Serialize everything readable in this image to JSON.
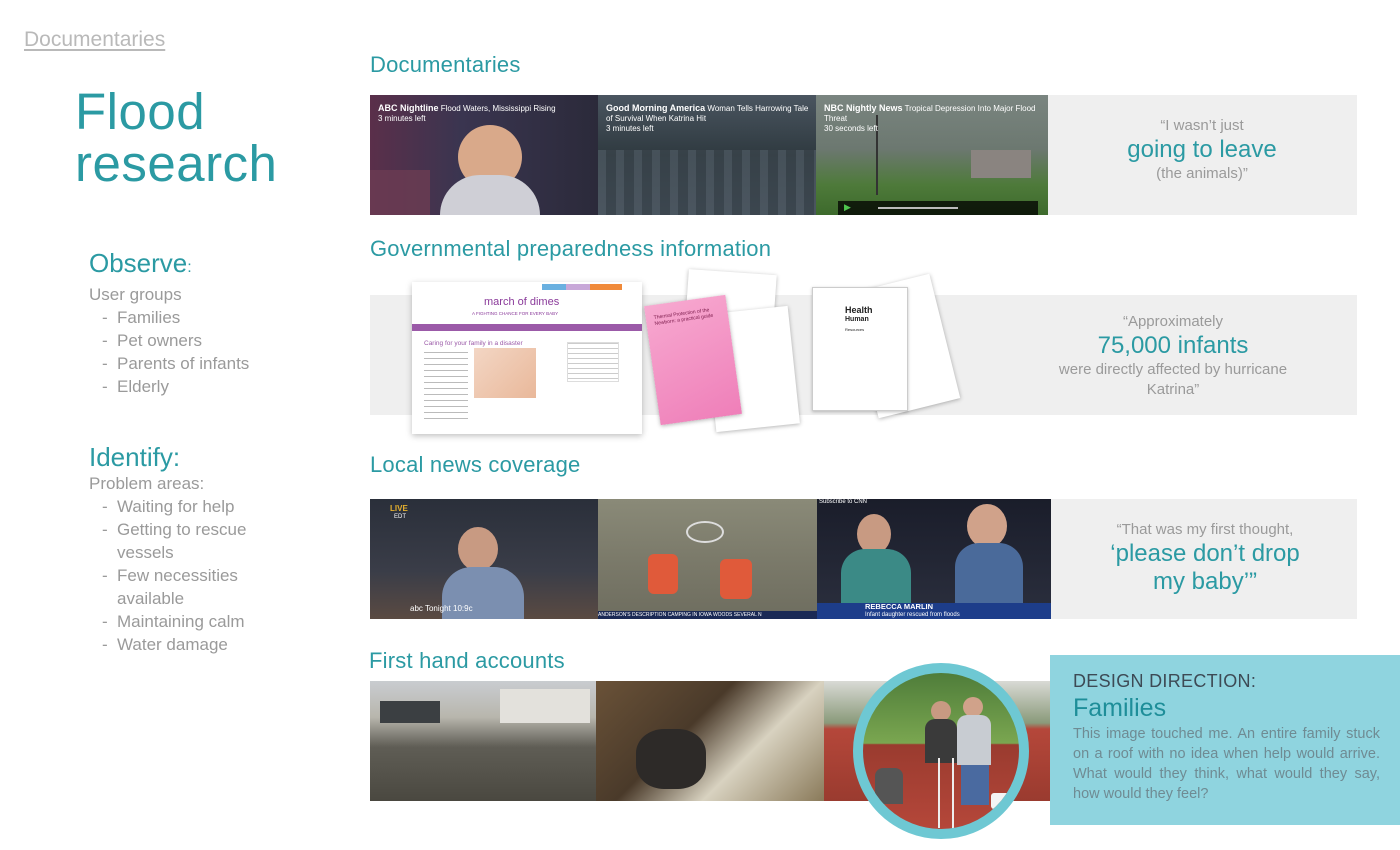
{
  "breadcrumb": "Documentaries",
  "title": {
    "line1": "Flood",
    "line2": "research"
  },
  "observe": {
    "heading": "Observe",
    "colon": ":",
    "subheading": "User groups",
    "items": [
      "Families",
      "Pet owners",
      "Parents of infants",
      "Elderly"
    ]
  },
  "identify": {
    "heading": "Identify:",
    "subheading": "Problem areas:",
    "items": [
      "Waiting for help",
      "Getting to rescue vessels",
      "Few necessities available",
      "Maintaining calm",
      "Water damage"
    ]
  },
  "sections": {
    "documentaries": {
      "title": "Documentaries",
      "videos": [
        {
          "channel": "ABC Nightline",
          "text": "Flood Waters, Mississippi Rising",
          "time": "3 minutes left"
        },
        {
          "channel": "Good Morning America",
          "text": "Woman Tells Harrowing Tale of Survival When Katrina Hit",
          "time": "3 minutes left"
        },
        {
          "channel": "NBC Nightly News",
          "text": "Tropical Depression Into Major Flood Threat",
          "time": "30 seconds left"
        }
      ],
      "quote": {
        "line1": "“I wasn’t just",
        "big": "going to leave",
        "line3": "(the animals)”"
      }
    },
    "government": {
      "title": "Governmental preparedness information",
      "website": {
        "logo": "march of dimes",
        "tagline": "A FIGHTING CHANCE FOR EVERY BABY",
        "heading": "Caring for your family in a disaster"
      },
      "brochure1": "Thermal Protection of the Newborn: a practical guide",
      "brochure2": {
        "line1": "Health",
        "line2": "Human",
        "line3": "Resources"
      },
      "quote": {
        "line1": "“Approximately",
        "big": "75,000 infants",
        "line3": "were directly affected by hurricane Katrina”"
      }
    },
    "local_news": {
      "title": "Local news coverage",
      "clips": [
        {
          "badge": "LIVE",
          "sub": "EDT",
          "lower": "abc Tonight 10:9c"
        },
        {
          "lower": "ANDERSON'S DESCRIPTION CAMPING IN IOWA WOODS SEVERAL N"
        },
        {
          "top": "Subscribe to CNN",
          "name": "REBECCA MARLIN",
          "caption": "Infant daughter rescued from floods"
        }
      ],
      "quote": {
        "line1": "“That was my first thought,",
        "big1": "‘please don’t drop",
        "big2": "my baby’”"
      }
    },
    "first_hand": {
      "title": "First hand accounts"
    }
  },
  "design_direction": {
    "label": "DESIGN DIRECTION:",
    "heading": "Families",
    "body": "This image touched me. An entire family stuck on a roof with no idea when help would arrive. What would they think, what would they say, how would they feel?"
  }
}
